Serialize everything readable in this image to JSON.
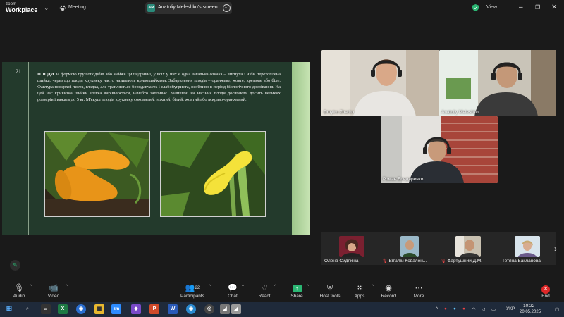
{
  "app": {
    "logo_top": "zoom",
    "logo_bottom": "Workplace",
    "meeting_label": "Meeting"
  },
  "share": {
    "badge": "AM",
    "label": "Anatoliy Meleshko's screen"
  },
  "view_label": "View",
  "slide": {
    "number": "21",
    "bold_word": "ПЛОДИ",
    "text": " за формою грушоподібні або майже циліндричні, у всіх у них є одна загальна ознака – вигнута і ніби перехоплена шийка, через що плоди крукнеку часто називають кривошийками. Забарвлення плодів – оранжеве, жовте, кремове або біле. Фактура поверхні чиста, гладка, але трапляється бородавчаста і слабобугриста, особливо в період біологічного дозрівання. На цей час кривизна шийки злегка вирівнюється, начебто запливає. Залишені на насіння плоди досягають досить великих розмірів і важать до 5 кг. М'якуш плодів крукнеку соковитий, ніжний, білий, жовтий або яскраво-оранжевий."
  },
  "participants_video": [
    {
      "name": "Dmytro Zharko"
    },
    {
      "name": "Anatoliy Meleshko"
    },
    {
      "name": "Роман Бондаренко"
    }
  ],
  "strip": [
    {
      "name": "Олена Сидякіна"
    },
    {
      "name": "Віталій Ковален..."
    },
    {
      "name": "Фартушний Д.М."
    },
    {
      "name": "Тетяна Бакланова"
    }
  ],
  "toolbar": {
    "audio": "Audio",
    "video": "Video",
    "participants": "Participants",
    "participants_count": "22",
    "chat": "Chat",
    "react": "React",
    "share": "Share",
    "host_tools": "Host tools",
    "apps": "Apps",
    "record": "Record",
    "more": "More",
    "end": "End"
  },
  "taskbar": {
    "language": "УКР",
    "time": "10:22",
    "date": "20.05.2025"
  },
  "colors": {
    "accent_green": "#2bb673",
    "end_red": "#e02828",
    "slide_bg": "#233a2c"
  }
}
